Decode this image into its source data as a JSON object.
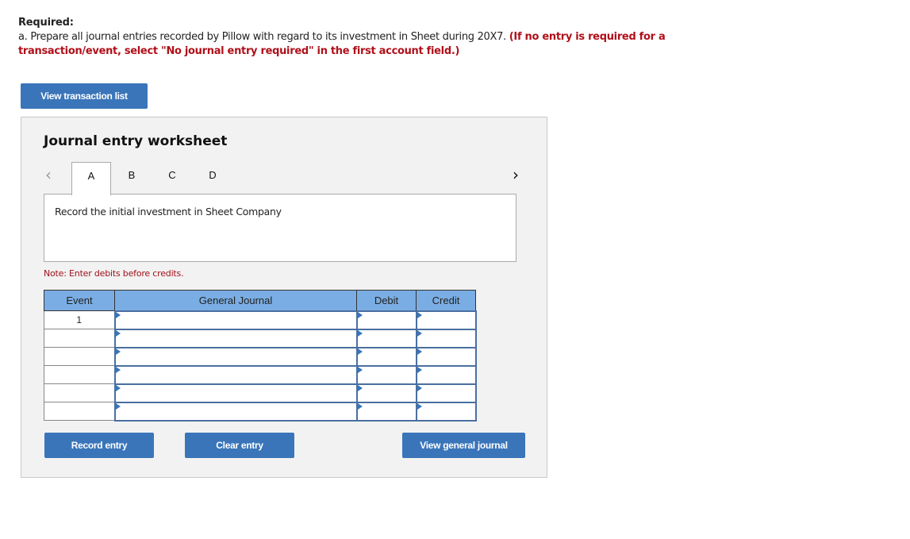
{
  "question": {
    "required_label": "Required:",
    "instruction_text": "a. Prepare all journal entries recorded by Pillow with regard to its investment in Sheet during 20X7. ",
    "instruction_emphasis": "(If no entry is required for a transaction/event, select \"No journal entry required\" in the first account field.)"
  },
  "buttons": {
    "view_transaction_list": "View transaction list",
    "record_entry": "Record entry",
    "clear_entry": "Clear entry",
    "view_general_journal": "View general journal"
  },
  "worksheet": {
    "title": "Journal entry worksheet",
    "nav_prev_icon": "chevron-left",
    "nav_next_icon": "chevron-right",
    "nav_prev_glyph": "‹",
    "nav_next_glyph": "›",
    "tabs": [
      {
        "label": "A",
        "active": true
      },
      {
        "label": "B",
        "active": false
      },
      {
        "label": "C",
        "active": false
      },
      {
        "label": "D",
        "active": false
      }
    ],
    "description": "Record the initial investment in Sheet Company",
    "note": "Note: Enter debits before credits."
  },
  "table": {
    "headers": {
      "event": "Event",
      "general_journal": "General Journal",
      "debit": "Debit",
      "credit": "Credit"
    },
    "rows": [
      {
        "event": "1",
        "account": "",
        "debit": "",
        "credit": ""
      },
      {
        "event": "",
        "account": "",
        "debit": "",
        "credit": ""
      },
      {
        "event": "",
        "account": "",
        "debit": "",
        "credit": ""
      },
      {
        "event": "",
        "account": "",
        "debit": "",
        "credit": ""
      },
      {
        "event": "",
        "account": "",
        "debit": "",
        "credit": ""
      },
      {
        "event": "",
        "account": "",
        "debit": "",
        "credit": ""
      }
    ]
  },
  "colors": {
    "button_blue": "#3a75ba",
    "header_blue": "#7aade3",
    "emphasis_red": "#b0101a",
    "panel_bg": "#f2f2f2"
  }
}
